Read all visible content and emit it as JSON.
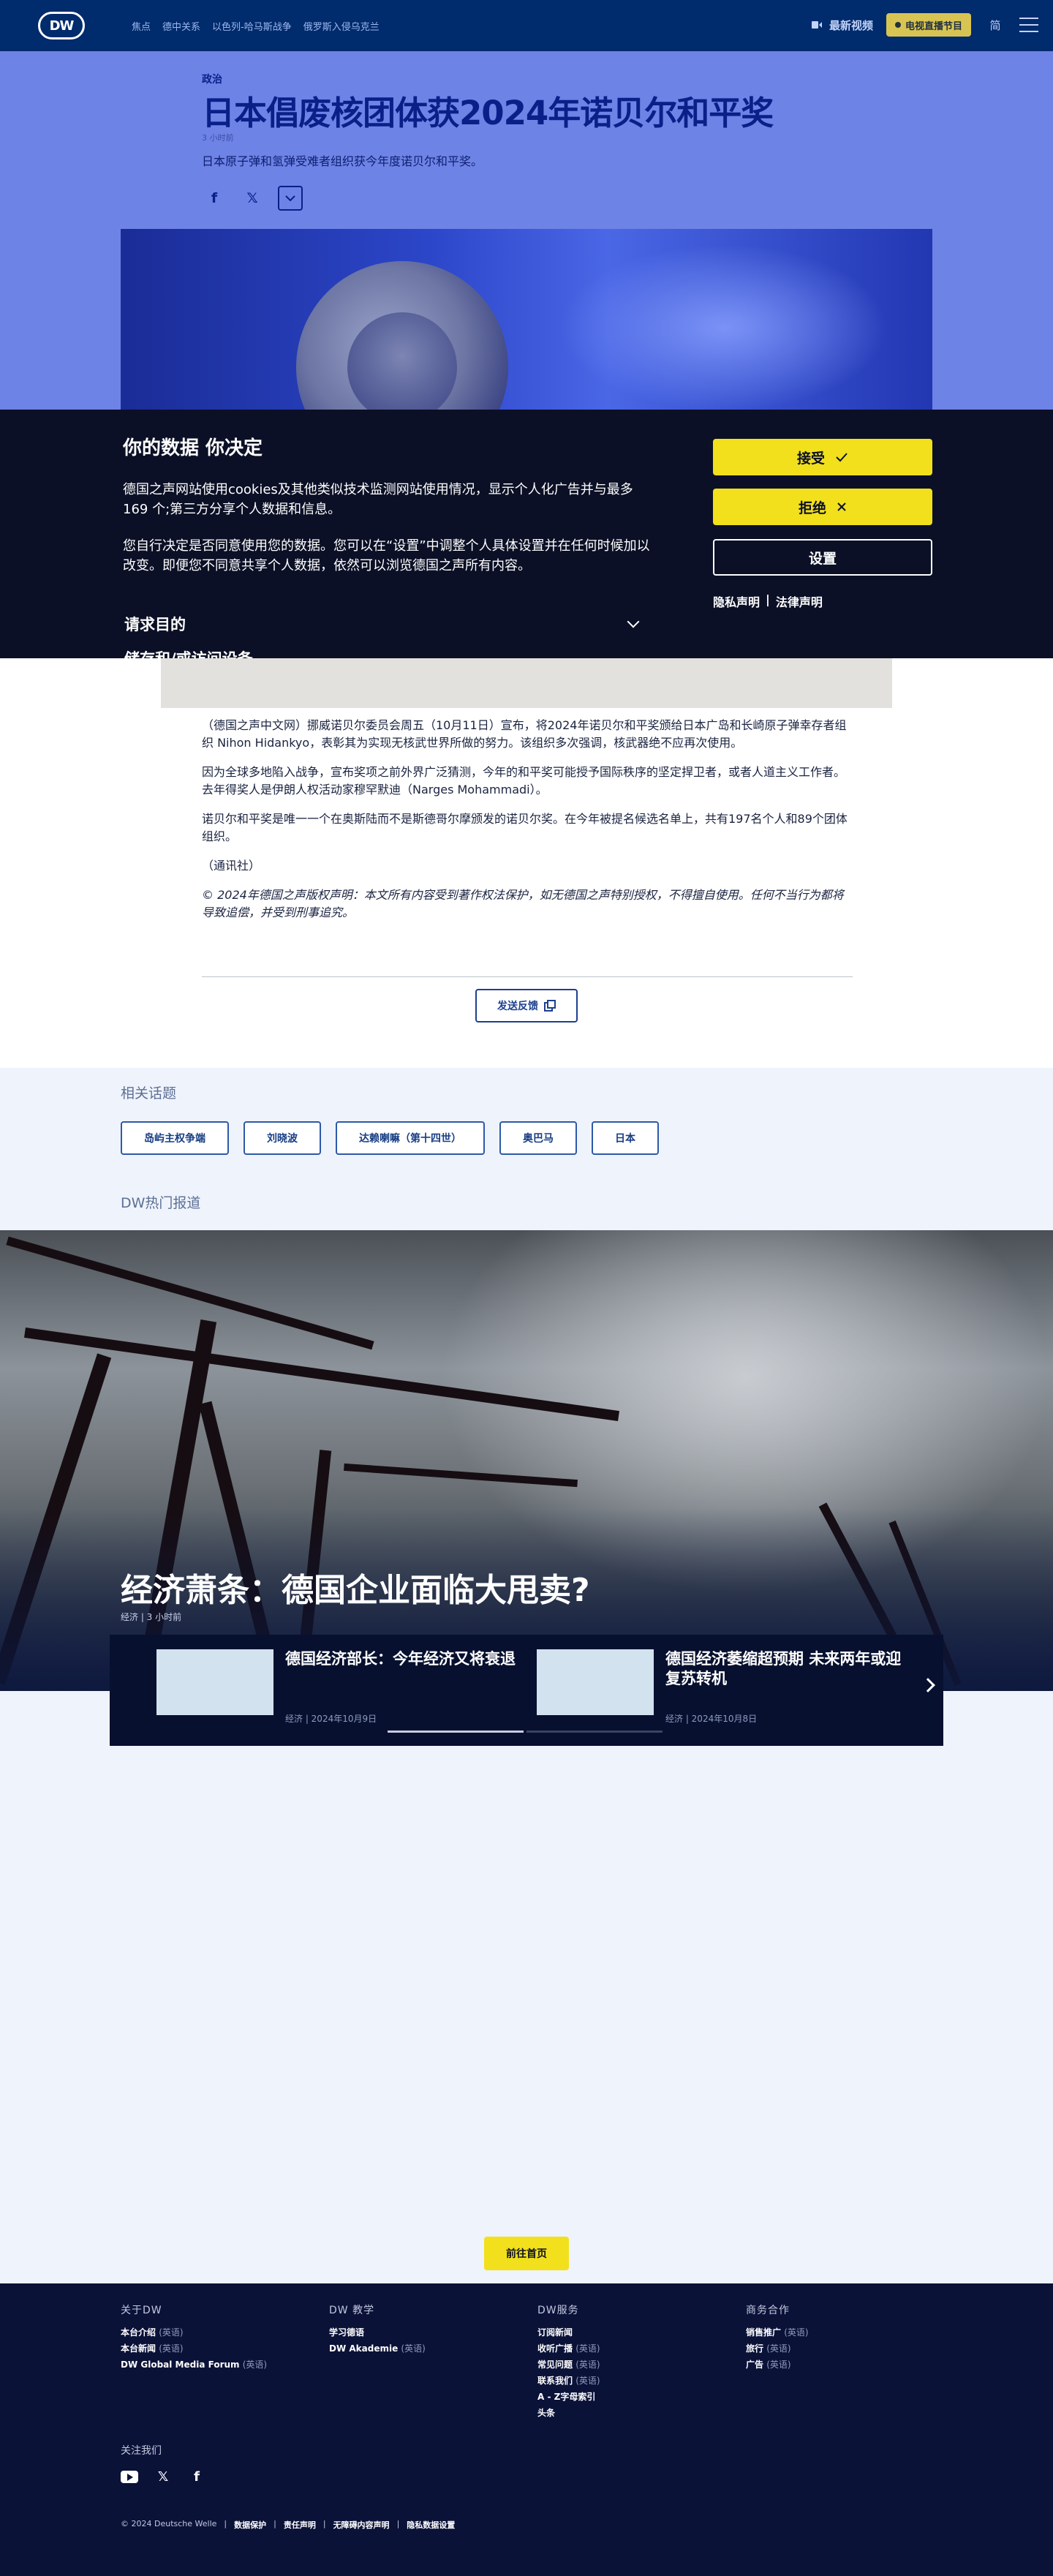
{
  "header": {
    "logo": "DW",
    "nav": [
      "焦点",
      "德中关系",
      "以色列-哈马斯战争",
      "俄罗斯入侵乌克兰"
    ],
    "video_label": "最新视频",
    "tv_label": "电视直播节目",
    "lang_label": "简"
  },
  "article": {
    "section": "政治",
    "title": "日本倡废核团体获2024年诺贝尔和平奖",
    "ago": "3 小时前",
    "lede": "日本原子弹和氢弹受难者组织获今年度诺贝尔和平奖。",
    "paragraphs": [
      "（德国之声中文网）挪威诺贝尔委员会周五（10月11日）宣布，将2024年诺贝尔和平奖颁给日本广岛和长崎原子弹幸存者组织 Nihon Hidankyo，表彰其为实现无核武世界所做的努力。该组织多次强调，核武器绝不应再次使用。",
      "因为全球多地陷入战争，宣布奖项之前外界广泛猜测，今年的和平奖可能授予国际秩序的坚定捍卫者，或者人道主义工作者。去年得奖人是伊朗人权活动家穆罕默迪（Narges Mohammadi）。",
      "诺贝尔和平奖是唯一一个在奥斯陆而不是斯德哥尔摩颁发的诺贝尔奖。在今年被提名候选名单上，共有197名个人和89个团体组织。",
      "（通讯社）"
    ],
    "copyright": "© 2024年德国之声版权声明：本文所有内容受到著作权法保护，如无德国之声特别授权，不得擅自使用。任何不当行为都将导致追偿，并受到刑事追究。",
    "feedback": "发送反馈"
  },
  "cookie": {
    "title": "你的数据 你决定",
    "p1": "德国之声网站使用cookies及其他类似技术监测网站使用情况，显示个人化广告并与最多169 个;第三方分享个人数据和信息。",
    "p2": "您自行决定是否同意使用您的数据。您可以在“设置”中调整个人具体设置并在任何时候加以改变。即便您不同意共享个人数据，依然可以浏览德国之声所有内容。",
    "purpose": "请求目的",
    "cut_text": "储存和/或访问设备",
    "accept": "接受",
    "reject": "拒绝",
    "settings": "设置",
    "privacy": "隐私声明",
    "sep": "|",
    "legal": "法律声明"
  },
  "related": {
    "label": "相关话题",
    "tags": [
      "岛屿主权争端",
      "刘晓波",
      "达赖喇嘛（第十四世）",
      "奥巴马",
      "日本"
    ]
  },
  "trending": {
    "label": "DW热门报道",
    "headline": "经济萧条：德国企业面临大甩卖?",
    "meta": "经济 | 3 小时前",
    "cards": [
      {
        "title": "德国经济部长：今年经济又将衰退",
        "meta": "经济 | 2024年10月9日"
      },
      {
        "title": "德国经济萎缩超预期 未来两年或迎复苏转机",
        "meta": "经济 | 2024年10月8日"
      }
    ]
  },
  "home_button": "前往首页",
  "footer": {
    "cols": [
      {
        "title": "关于DW",
        "items": [
          {
            "t": "本台介绍",
            "s": "(英语)"
          },
          {
            "t": "本台新闻",
            "s": "(英语)"
          },
          {
            "t": "DW Global Media Forum",
            "s": "(英语)"
          }
        ]
      },
      {
        "title": "DW 教学",
        "items": [
          {
            "t": "学习德语",
            "s": ""
          },
          {
            "t": "DW Akademie",
            "s": "(英语)"
          }
        ]
      },
      {
        "title": "DW服务",
        "items": [
          {
            "t": "订阅新闻",
            "s": ""
          },
          {
            "t": "收听广播",
            "s": "(英语)"
          },
          {
            "t": "常见问题",
            "s": "(英语)"
          },
          {
            "t": "联系我们",
            "s": "(英语)"
          },
          {
            "t": "A - Z字母索引",
            "s": ""
          },
          {
            "t": "头条",
            "s": ""
          }
        ]
      },
      {
        "title": "商务合作",
        "items": [
          {
            "t": "销售推广",
            "s": "(英语)"
          },
          {
            "t": "旅行",
            "s": "(英语)"
          },
          {
            "t": "广告",
            "s": "(英语)"
          }
        ]
      }
    ],
    "follow": "关注我们",
    "legal": [
      "© 2024 Deutsche Welle",
      "数据保护",
      "责任声明",
      "无障碍内容声明",
      "隐私数据设置"
    ]
  }
}
